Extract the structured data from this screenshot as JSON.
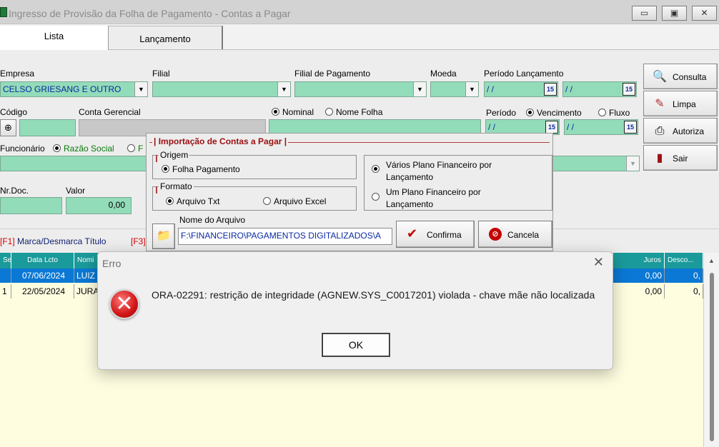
{
  "window": {
    "title": "Ingresso de Provisão da Folha de Pagamento - Contas a Pagar",
    "minimize": "▭",
    "maximize": "▣",
    "close": "✕"
  },
  "tabs": [
    {
      "label": "Lista"
    },
    {
      "label": "Lançamento"
    }
  ],
  "form": {
    "empresa_label": "Empresa",
    "empresa_value": "CELSO GRIESANG E OUTRO",
    "filial_label": "Filial",
    "filial_pagamento_label": "Filial de Pagamento",
    "moeda_label": "Moeda",
    "periodo_lancamento_label": "Período Lançamento",
    "date_placeholder_1": "/ /",
    "date_placeholder_2": "/ /",
    "date_placeholder_3": "/ /",
    "date_placeholder_4": "/ /",
    "cal_glyph": "15",
    "codigo_label": "Código",
    "conta_gerencial_label": "Conta Gerencial",
    "nominal_label": "Nominal",
    "nome_folha_label": "Nome Folha",
    "periodo_label": "Período",
    "vencimento_label": "Vencimento",
    "fluxo_label": "Fluxo",
    "funcionario_label": "Funcionário",
    "razao_social_label": "Razão Social",
    "razao_social_partial": "F",
    "nrdoc_label": "Nr.Doc.",
    "valor_label": "Valor",
    "valor_value": "0,00"
  },
  "side_buttons": {
    "consulta": "Consulta",
    "limpa": "Limpa",
    "autoriza": "Autoriza",
    "sair": "Sair"
  },
  "fkeys": {
    "f1_key": "[F1]",
    "f1_text": "Marca/Desmarca Título",
    "f3_key": "[F3]"
  },
  "grid": {
    "headers": [
      "Sel",
      "Data Lcto",
      "Nomi",
      "Juros",
      "Desco..."
    ],
    "rows": [
      {
        "sel": "",
        "data": "07/06/2024",
        "nome": "LUIZ",
        "juros": "0,00",
        "desc": "0,"
      },
      {
        "sel": "1",
        "data": "22/05/2024",
        "nome": "JURA",
        "juros": "0,00",
        "desc": "0,"
      }
    ]
  },
  "import_dialog": {
    "caption": "| Importação de Contas a Pagar |",
    "origem_label": "Origem",
    "folha_pagamento": "Folha Pagamento",
    "formato_label": "Formato",
    "arquivo_txt": "Arquivo Txt",
    "arquivo_excel": "Arquivo Excel",
    "varios_line1": "Vários Plano Financeiro por",
    "varios_line2": "Lançamento",
    "um_line1": "Um Plano Financeiro por",
    "um_line2": "Lançamento",
    "nome_arquivo_label": "Nome do Arquivo",
    "arquivo_path": "F:\\FINANCEIRO\\PAGAMENTOS DIGITALIZADOS\\A",
    "confirma": "Confirma",
    "cancela": "Cancela"
  },
  "error_dialog": {
    "title": "Erro",
    "message": "ORA-02291: restrição de integridade (AGNEW.SYS_C0017201) violada - chave mãe não localizada",
    "ok": "OK"
  },
  "colors": {
    "field_green": "#93dcb9",
    "grid_header": "#1a9a9a",
    "selected_row": "#0a78d4",
    "grid_bg": "#fffde0",
    "accent_red": "#d40000"
  }
}
